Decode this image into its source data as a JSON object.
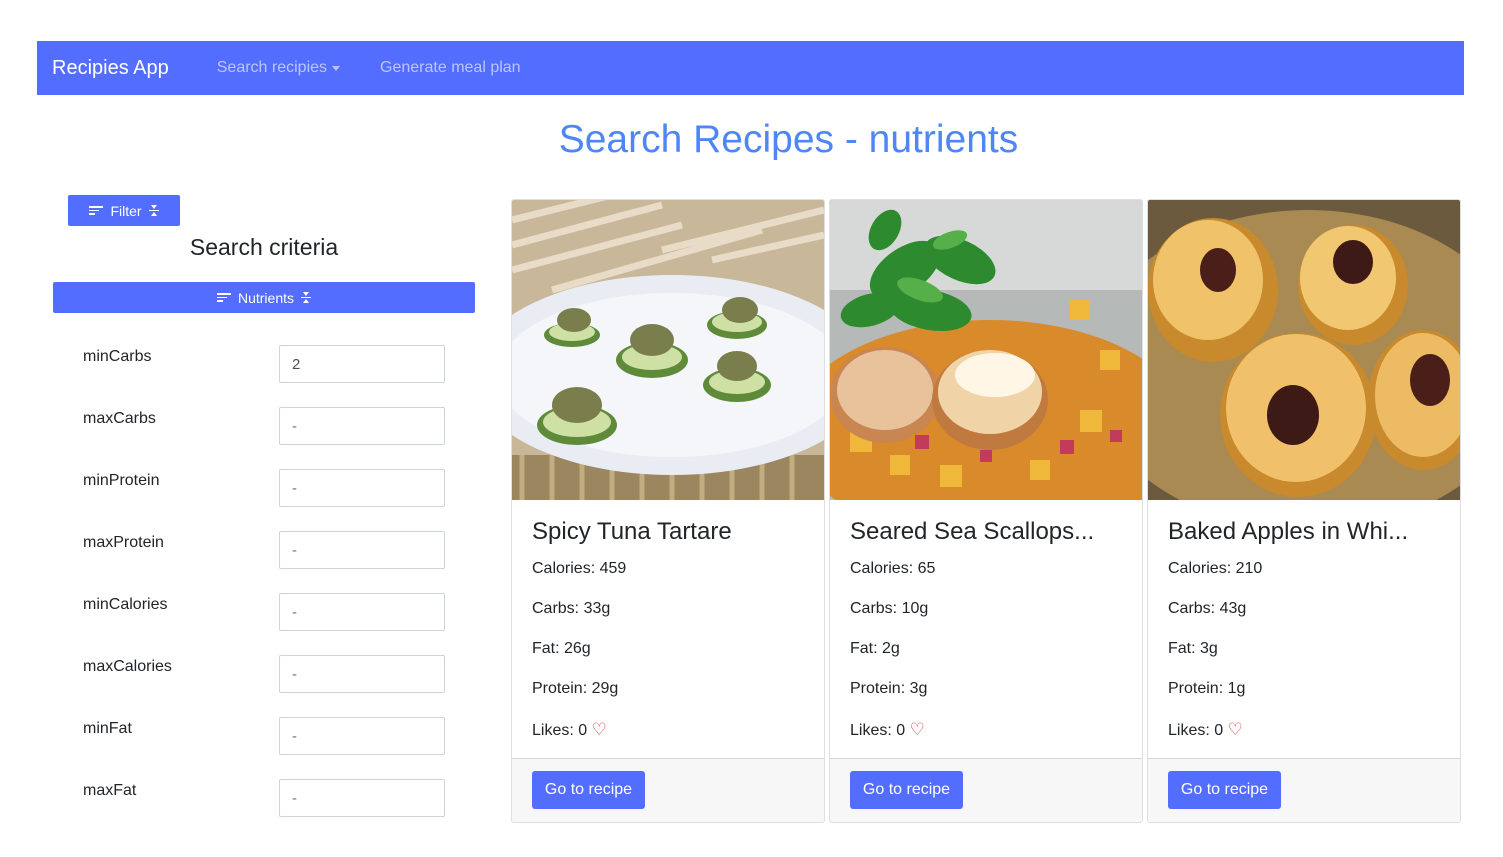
{
  "navbar": {
    "brand": "Recipies App",
    "links": [
      {
        "label": "Search recipies",
        "dropdown": true
      },
      {
        "label": "Generate meal plan",
        "dropdown": false
      }
    ]
  },
  "page": {
    "title": "Search Recipes - nutrients"
  },
  "filter": {
    "filter_button": "Filter",
    "criteria_title": "Search criteria",
    "nutrients_button": "Nutrients",
    "fields": [
      {
        "label": "minCarbs",
        "value": "2",
        "placeholder": "-"
      },
      {
        "label": "maxCarbs",
        "value": "",
        "placeholder": "-"
      },
      {
        "label": "minProtein",
        "value": "",
        "placeholder": "-"
      },
      {
        "label": "maxProtein",
        "value": "",
        "placeholder": "-"
      },
      {
        "label": "minCalories",
        "value": "",
        "placeholder": "-"
      },
      {
        "label": "maxCalories",
        "value": "",
        "placeholder": "-"
      },
      {
        "label": "minFat",
        "value": "",
        "placeholder": "-"
      },
      {
        "label": "maxFat",
        "value": "",
        "placeholder": "-"
      }
    ]
  },
  "recipes": [
    {
      "title": "Spicy Tuna Tartare",
      "calories": "Calories: 459",
      "carbs": "Carbs: 33g",
      "fat": "Fat: 26g",
      "protein": "Protein: 29g",
      "likes": "Likes: 0",
      "button": "Go to recipe"
    },
    {
      "title": "Seared Sea Scallops...",
      "calories": "Calories: 65",
      "carbs": "Carbs: 10g",
      "fat": "Fat: 2g",
      "protein": "Protein: 3g",
      "likes": "Likes: 0",
      "button": "Go to recipe"
    },
    {
      "title": "Baked Apples in Whi...",
      "calories": "Calories: 210",
      "carbs": "Carbs: 43g",
      "fat": "Fat: 3g",
      "protein": "Protein: 1g",
      "likes": "Likes: 0",
      "button": "Go to recipe"
    }
  ],
  "icons": {
    "heart": "heart-outline-icon",
    "filter": "filter-lines-icon",
    "collapse": "collapse-arrows-icon"
  },
  "colors": {
    "primary": "#536dfe",
    "title": "#4f86f7",
    "heart": "#e3342f"
  }
}
